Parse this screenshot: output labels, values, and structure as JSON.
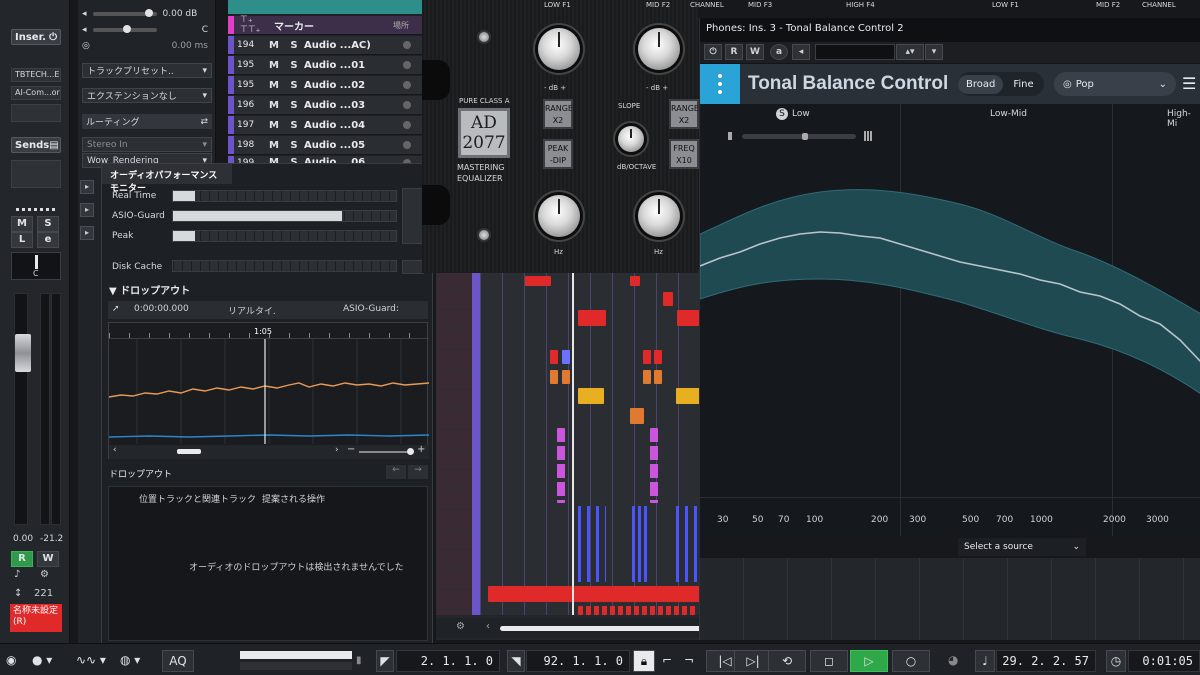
{
  "mixer": {
    "insert_label": "Inser.",
    "insert_slots": [
      "TBTECH...EQ",
      "AI-Com...or"
    ],
    "sends_label": "Sends",
    "buttons": [
      "M",
      "S",
      "L",
      "e"
    ],
    "pan_value": "C",
    "gain_left": "0.00",
    "gain_right": "-21.2",
    "read_label": "R",
    "write_label": "W",
    "track_number": "221",
    "channel_name": "名称未設定 (R)"
  },
  "inspector": {
    "volume_value": "0.00 dB",
    "pan_value": "C",
    "delay_value": "0.00 ms",
    "track_preset": "トラックプリセット..",
    "extension": "エクステンションなし",
    "routing_label": "ルーティング",
    "input": "Stereo In",
    "output": "Wow_Rendering"
  },
  "tracks": {
    "header": "マーカー",
    "header_right": "場所",
    "rows": [
      {
        "num": "194",
        "name": "Audio ...AC)"
      },
      {
        "num": "195",
        "name": "Audio ...01"
      },
      {
        "num": "195",
        "name": "Audio ...02"
      },
      {
        "num": "196",
        "name": "Audio ...03"
      },
      {
        "num": "197",
        "name": "Audio ...04"
      },
      {
        "num": "198",
        "name": "Audio ...05"
      },
      {
        "num": "199",
        "name": "Audio ...06"
      }
    ],
    "mute": "M",
    "solo": "S"
  },
  "apm": {
    "title": "オーディオパフォーマンスモニター",
    "real_time_label": "Real Time",
    "real_time_pct": 0.1,
    "asio_guard_label": "ASIO-Guard",
    "asio_guard_pct": 0.76,
    "peak_label": "Peak",
    "peak_pct": 0.1,
    "disk_cache_label": "Disk Cache",
    "disk_cache_pct": 0.0,
    "dropout_section": "ドロップアウト",
    "time_readout": "0:00:00.000",
    "realtime_col": "リアルタイ.",
    "asio_col": "ASIO-Guard:",
    "graph_marker": "1:05",
    "dropout_section2": "ドロップアウト",
    "col_tracks": "位置トラックと関連トラック",
    "col_actions": "提案される操作",
    "no_dropouts": "オーディオのドロップアウトは検出されませんでした"
  },
  "eq": {
    "low_f1": "LOW F1",
    "mid_f2": "MID F2",
    "channel": "CHANNEL",
    "mid_f3": "MID F3",
    "high_f4": "HIGH F4",
    "db_label": "- dB +",
    "brand_line1": "PURE CLASS A",
    "model": "AD 2077",
    "brand_line2": "MASTERING",
    "brand_line3": "EQUALIZER",
    "range_x2": "RANGE X2",
    "peak_dip": "PEAK -DIP",
    "slope": "SLOPE",
    "freq_x10": "FREQ X10",
    "db_octave": "dB/OCTAVE",
    "hz": "Hz"
  },
  "tbc": {
    "window_title": "Phones: Ins. 3 - Tonal Balance Control 2",
    "toolbar_r": "R",
    "toolbar_w": "W",
    "toolbar_a": "a",
    "app_title": "Tonal Balance Control",
    "broad": "Broad",
    "fine": "Fine",
    "target": "Pop",
    "band_low": "Low",
    "band_lowmid": "Low-Mid",
    "band_high": "High-Mi",
    "solo_badge": "S",
    "freq_ticks": [
      "30",
      "50",
      "70",
      "100",
      "200",
      "300",
      "500",
      "700",
      "1000",
      "2000",
      "3000"
    ],
    "source_select": "Select a source",
    "colors": {
      "accent": "#2aa3d6",
      "band_fill": "#1f4a52",
      "curve": "#b9c6c9"
    }
  },
  "transport": {
    "left_locator": "2. 1. 1.   0",
    "right_locator": "92. 1. 1.   0",
    "primary_position": "29. 2. 2. 57",
    "secondary_position": "0:01:05",
    "aq_label": "AQ"
  }
}
